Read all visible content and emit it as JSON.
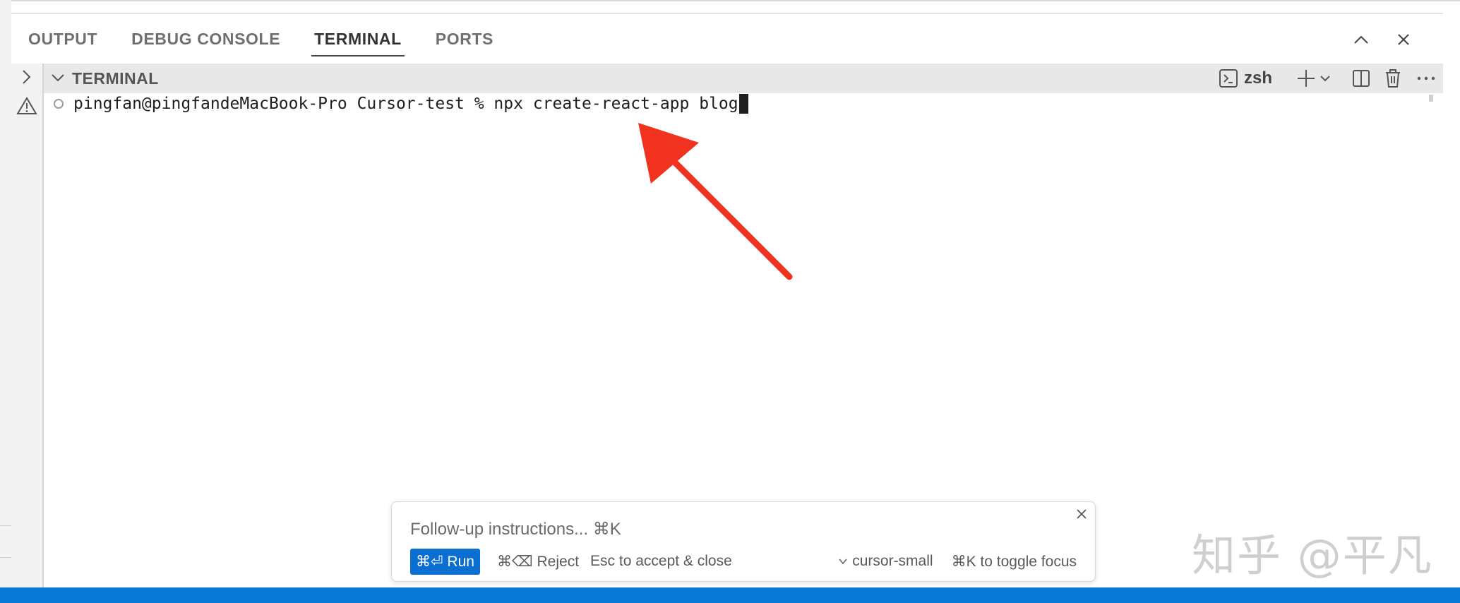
{
  "panel": {
    "tabs": [
      {
        "label": "OUTPUT",
        "active": false
      },
      {
        "label": "DEBUG CONSOLE",
        "active": false
      },
      {
        "label": "TERMINAL",
        "active": true
      },
      {
        "label": "PORTS",
        "active": false
      }
    ],
    "actions": {
      "maximize_icon": "chevron-up-icon",
      "close_icon": "close-icon"
    }
  },
  "terminal": {
    "section_title": "TERMINAL",
    "shell_label": "zsh",
    "tools": [
      "terminal-icon",
      "add-icon",
      "chevron-down-icon",
      "split-icon",
      "trash-icon",
      "more-icon"
    ],
    "prompt_line": "pingfan@pingfandeMacBook-Pro Cursor-test % npx create-react-app blog"
  },
  "followup": {
    "placeholder": "Follow-up instructions... ⌘K",
    "run_label": "⌘⏎ Run",
    "reject_label": "⌘⌫ Reject",
    "esc_label": "Esc to accept & close",
    "model_label": "cursor-small",
    "toggle_label": "⌘K to toggle focus"
  },
  "watermark": "知乎 @平凡",
  "colors": {
    "accent": "#0a6fd0",
    "statusbar": "#0a78d6",
    "annotation_arrow": "#f0321e"
  }
}
